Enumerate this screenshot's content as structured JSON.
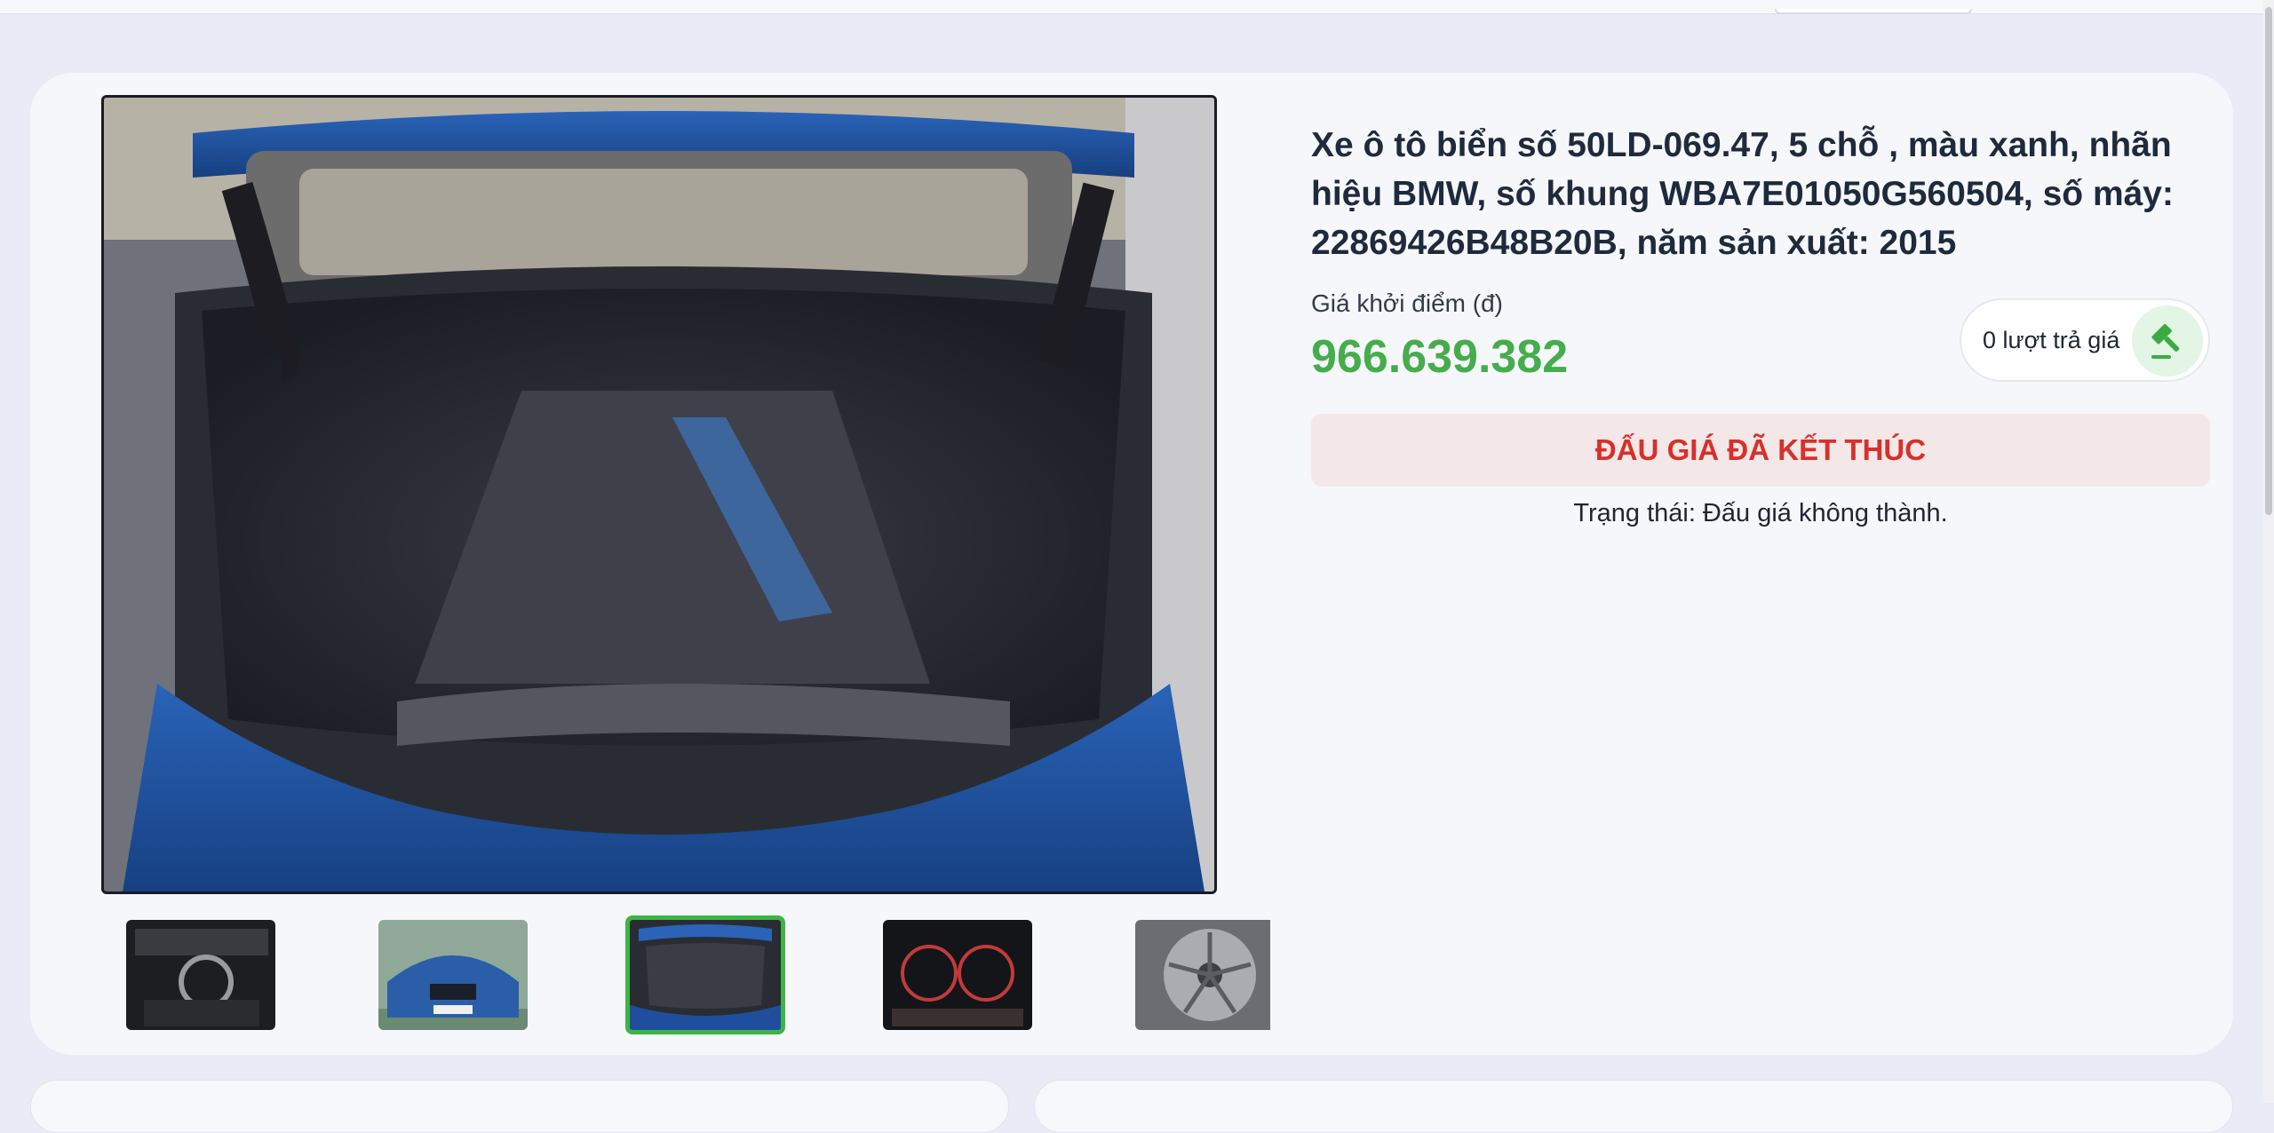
{
  "listing": {
    "title": "Xe ô tô biển số 50LD-069.47, 5 chỗ , màu xanh, nhãn hiệu BMW, số khung WBA7E01050G560504, số máy: 22869426B48B20B, năm sản xuất: 2015",
    "price_label": "Giá khởi điểm (đ)",
    "price": "966.639.382",
    "bid_count": "0 lượt trả giá",
    "auction_state_button": "ĐẤU GIÁ ĐÃ KẾT THÚC",
    "status": "Trạng thái: Đấu giá không thành."
  },
  "gallery": {
    "active_index": 2,
    "thumbnails": [
      "car-interior",
      "car-front",
      "car-trunk",
      "car-dashboard",
      "car-wheel"
    ]
  },
  "colors": {
    "price": "#45ad4c",
    "ended_text": "#d6302b",
    "ended_bg": "#f4e7e8",
    "active_thumb_border": "#3db545",
    "icon": "#3aab44"
  },
  "icons": {
    "bid": "gavel-icon"
  }
}
